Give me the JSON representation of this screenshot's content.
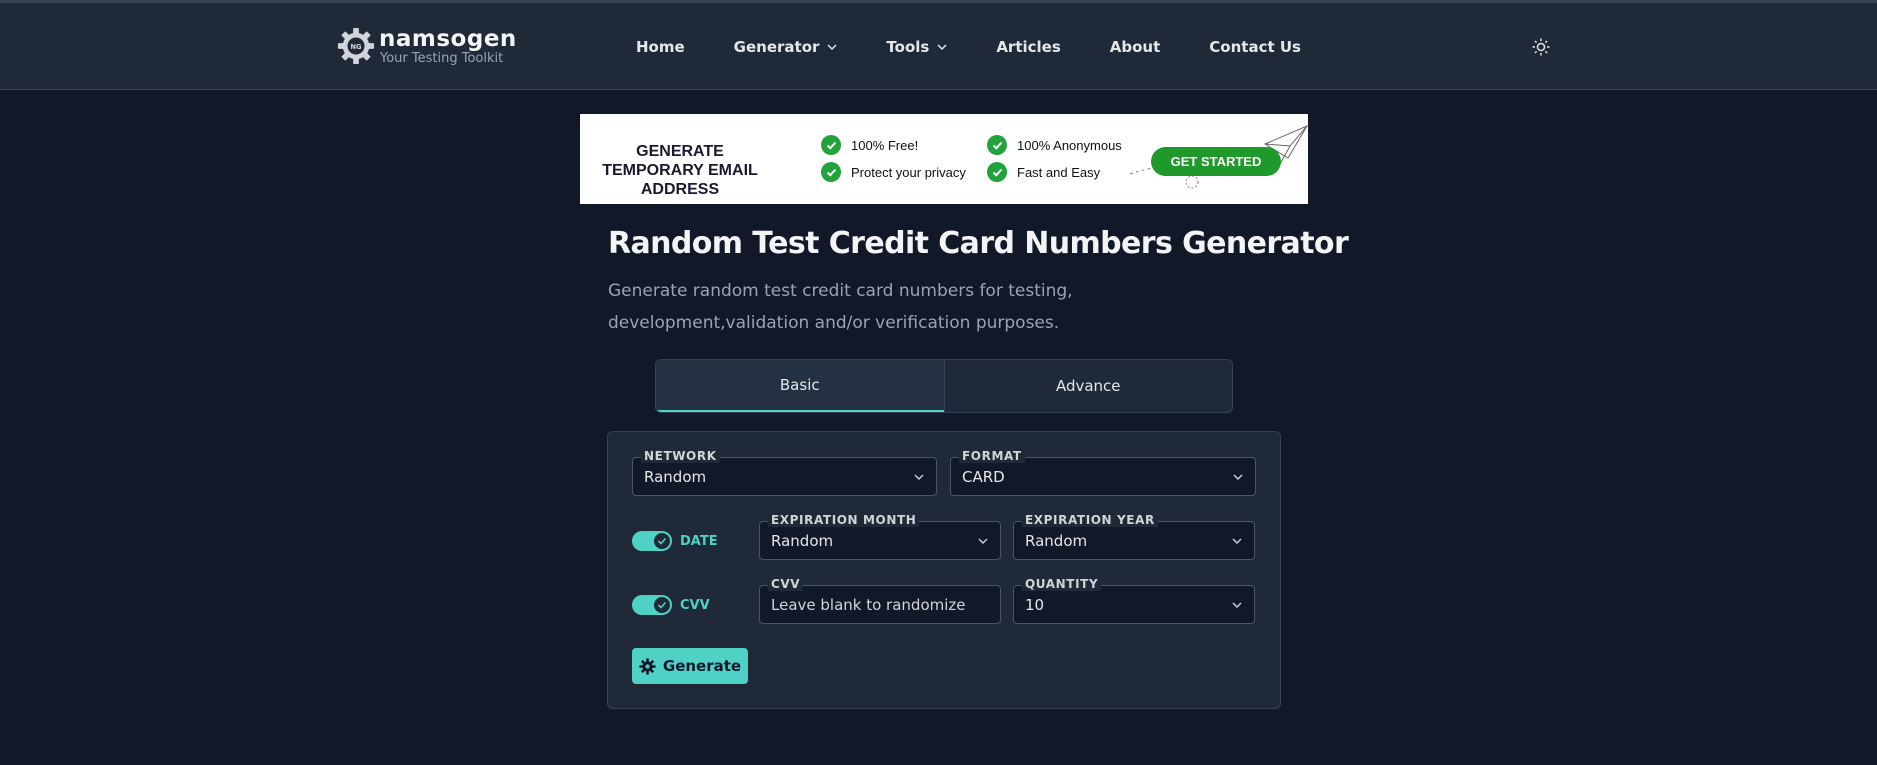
{
  "brand": {
    "name": "namsogen",
    "tagline": "Your Testing Toolkit",
    "badge": "NG"
  },
  "nav": {
    "items": [
      {
        "label": "Home",
        "has_dropdown": false
      },
      {
        "label": "Generator",
        "has_dropdown": true
      },
      {
        "label": "Tools",
        "has_dropdown": true
      },
      {
        "label": "Articles",
        "has_dropdown": false
      },
      {
        "label": "About",
        "has_dropdown": false
      },
      {
        "label": "Contact Us",
        "has_dropdown": false
      }
    ],
    "theme_icon": "sun-icon"
  },
  "ad": {
    "title": "GENERATE TEMPORARY EMAIL ADDRESS",
    "features": [
      "100% Free!",
      "Protect your privacy",
      "100% Anonymous",
      "Fast and Easy"
    ],
    "cta": "GET STARTED"
  },
  "page": {
    "title": "Random Test Credit Card Numbers Generator",
    "description": "Generate random test credit card numbers for testing, development,validation and/or verification purposes."
  },
  "tabs": [
    {
      "label": "Basic",
      "active": true
    },
    {
      "label": "Advance",
      "active": false
    }
  ],
  "form": {
    "network": {
      "label": "NETWORK",
      "value": "Random"
    },
    "format": {
      "label": "FORMAT",
      "value": "CARD"
    },
    "date_toggle": {
      "label": "DATE",
      "on": true
    },
    "expiration_month": {
      "label": "EXPIRATION MONTH",
      "value": "Random"
    },
    "expiration_year": {
      "label": "EXPIRATION YEAR",
      "value": "Random"
    },
    "cvv_toggle": {
      "label": "CVV",
      "on": true
    },
    "cvv": {
      "label": "CVV",
      "placeholder": "Leave blank to randomize"
    },
    "quantity": {
      "label": "QUANTITY",
      "value": "10"
    },
    "generate_button": "Generate"
  },
  "colors": {
    "background": "#111827",
    "header": "#1f2937",
    "accent": "#4fd1c5",
    "ad_green": "#1f9a2a"
  }
}
